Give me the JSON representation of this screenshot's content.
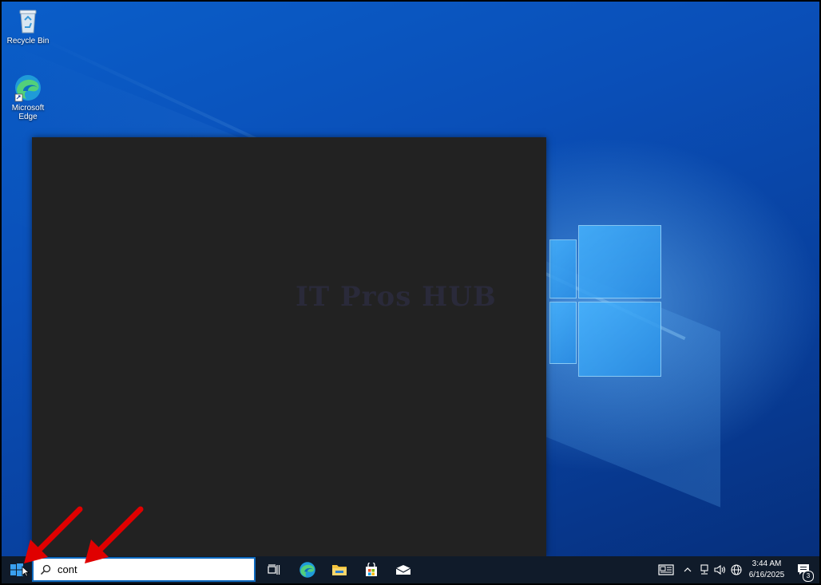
{
  "desktop": {
    "icons": [
      {
        "label": "Recycle Bin",
        "icon": "recycle-bin-icon"
      },
      {
        "label": "Microsoft Edge",
        "icon": "edge-icon"
      }
    ],
    "watermark": "IT Pros HUB"
  },
  "taskbar": {
    "start_icon": "windows-start-icon",
    "search": {
      "value": "cont",
      "icon": "search-icon"
    },
    "pinned": [
      {
        "name": "task-view",
        "icon": "task-view-icon"
      },
      {
        "name": "edge",
        "icon": "edge-icon"
      },
      {
        "name": "file-explorer",
        "icon": "folder-icon"
      },
      {
        "name": "store",
        "icon": "store-icon"
      },
      {
        "name": "mail",
        "icon": "mail-icon"
      }
    ],
    "tray": {
      "icons": [
        "news-icon",
        "chevron-up-icon",
        "network-icon",
        "volume-icon",
        "language-icon"
      ],
      "time": "3:44 AM",
      "date": "6/16/2025",
      "notification_count": "3"
    }
  },
  "colors": {
    "accent": "#0f6bc0",
    "taskbar": "#101b2a",
    "popup": "#222222",
    "annotation_arrow": "#e00000"
  }
}
